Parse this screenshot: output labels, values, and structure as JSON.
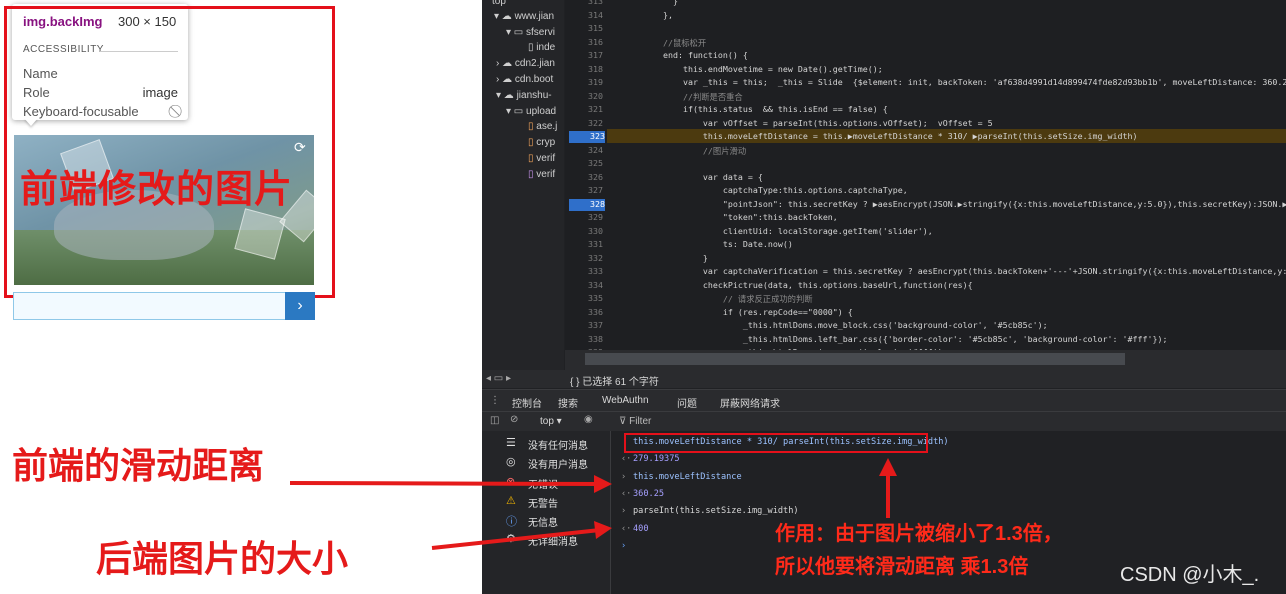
{
  "tooltip": {
    "selector": "img.backImg",
    "dimensions": "300 × 150",
    "section": "ACCESSIBILITY",
    "rows": [
      {
        "label": "Name",
        "value": ""
      },
      {
        "label": "Role",
        "value": "image"
      },
      {
        "label": "Keyboard-focusable",
        "value": ""
      }
    ]
  },
  "left_annotation": "前端修改的图片",
  "slider": {
    "arrow": "›"
  },
  "file_tree": [
    "top",
    "www.jian",
    "sfservi",
    "inde",
    "cdn2.jian",
    "cdn.boot",
    "jianshu-",
    "upload",
    "ase.j",
    "cryp",
    "verif",
    "verif"
  ],
  "code_lines": [
    {
      "n": "313",
      "t": "        }"
    },
    {
      "n": "314",
      "t": "      },"
    },
    {
      "n": "315",
      "t": ""
    },
    {
      "n": "316",
      "t": "      //鼠标松开"
    },
    {
      "n": "317",
      "t": "      end: function() {"
    },
    {
      "n": "318",
      "t": "          this.endMovetime = new Date().getTime();"
    },
    {
      "n": "319",
      "t": "          var _this = this;  _this = Slide  {$element: init, backToken: 'af638d4991d14d899474fde82d93bb1b', moveLeftDistance: 360.25, secr"
    },
    {
      "n": "320",
      "t": "          //判断是否重合"
    },
    {
      "n": "321",
      "t": "          if(this.status  && this.isEnd == false) {"
    },
    {
      "n": "322",
      "t": "              var vOffset = parseInt(this.options.vOffset);  vOffset = 5"
    },
    {
      "n": "323",
      "t": "              this.moveLeftDistance = this.▶moveLeftDistance * 310/ ▶parseInt(this.setSize.img_width)"
    },
    {
      "n": "324",
      "t": "              //图片滑动"
    },
    {
      "n": "325",
      "t": ""
    },
    {
      "n": "326",
      "t": "              var data = {"
    },
    {
      "n": "327",
      "t": "                  captchaType:this.options.captchaType,"
    },
    {
      "n": "328",
      "t": "                  \"pointJson\": this.secretKey ? ▶aesEncrypt(JSON.▶stringify({x:this.moveLeftDistance,y:5.0}),this.secretKey):JSON.▶string"
    },
    {
      "n": "329",
      "t": "                  \"token\":this.backToken,"
    },
    {
      "n": "330",
      "t": "                  clientUid: localStorage.getItem('slider'),"
    },
    {
      "n": "331",
      "t": "                  ts: Date.now()"
    },
    {
      "n": "332",
      "t": "              }"
    },
    {
      "n": "333",
      "t": "              var captchaVerification = this.secretKey ? aesEncrypt(this.backToken+'---'+JSON.stringify({x:this.moveLeftDistance,y:5.0}),th"
    },
    {
      "n": "334",
      "t": "              checkPictrue(data, this.options.baseUrl,function(res){"
    },
    {
      "n": "335",
      "t": "                  // 请求反正成功的判断"
    },
    {
      "n": "336",
      "t": "                  if (res.repCode==\"0000\") {"
    },
    {
      "n": "337",
      "t": "                      _this.htmlDoms.move_block.css('background-color', '#5cb85c');"
    },
    {
      "n": "338",
      "t": "                      _this.htmlDoms.left_bar.css({'border-color': '#5cb85c', 'background-color': '#fff'});"
    },
    {
      "n": "339",
      "t": "                      _this.htmlDoms.icon.css('color', '#fff');"
    }
  ],
  "breakpoints": [
    "323",
    "328"
  ],
  "status": "{ }  已选择 61 个字符",
  "tabs": [
    "控制台",
    "搜索",
    "WebAuthn",
    "问题",
    "屏蔽网络请求"
  ],
  "console_toolbar": {
    "context": "top ▾",
    "filter": "Filter"
  },
  "sidebar": [
    {
      "icon": "list-icon",
      "glyph": "☰",
      "label": "没有任何消息"
    },
    {
      "icon": "user-icon",
      "glyph": "◎",
      "label": "没有用户消息"
    },
    {
      "icon": "error-icon",
      "glyph": "⊗",
      "label": "无错误"
    },
    {
      "icon": "warning-icon",
      "glyph": "⚠",
      "label": "无警告"
    },
    {
      "icon": "info-icon",
      "glyph": "ⓘ",
      "label": "无信息"
    },
    {
      "icon": "verbose-icon",
      "glyph": "⚙",
      "label": "无详细消息"
    }
  ],
  "console_lines": [
    {
      "prefix": "",
      "text": "this.moveLeftDistance * 310/ parseInt(this.setSize.img_width)",
      "kind": "input"
    },
    {
      "prefix": "‹·",
      "text": "279.19375",
      "kind": "result"
    },
    {
      "prefix": "›",
      "text": "this.moveLeftDistance",
      "kind": "input"
    },
    {
      "prefix": "‹·",
      "text": "360.25",
      "kind": "result"
    },
    {
      "prefix": "›",
      "text": "parseInt(this.setSize.img_width)",
      "kind": "input"
    },
    {
      "prefix": "‹·",
      "text": "400",
      "kind": "result"
    },
    {
      "prefix": "›",
      "text": "",
      "kind": "prompt"
    }
  ],
  "annotations": {
    "front_distance": "前端的滑动距离",
    "backend_size": "后端图片的大小",
    "note_line1": "作用：由于图片被缩小了1.3倍，",
    "note_line2": "所以他要将滑动距离 乘1.3倍",
    "watermark": "CSDN @小木_."
  },
  "colors": {
    "annotation_red": "#e51a1a",
    "devtools_bg": "#202124",
    "slider_blue": "#2b79c2"
  }
}
